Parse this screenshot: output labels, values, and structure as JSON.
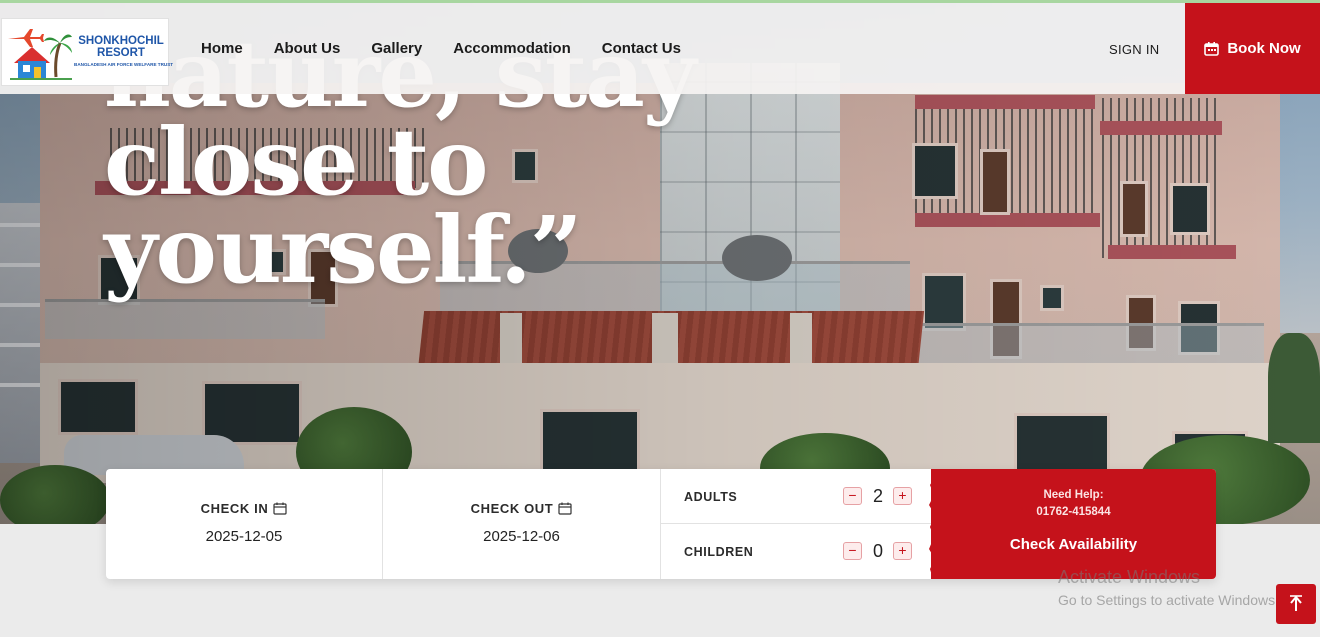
{
  "header": {
    "logo": {
      "title_line1": "SHONKHOCHIL",
      "title_line2": "RESORT",
      "subtitle": "BANGLADESH AIR FORCE WELFARE TRUST"
    },
    "nav": [
      "Home",
      "About Us",
      "Gallery",
      "Accommodation",
      "Contact Us"
    ],
    "sign_in": "SIGN IN",
    "book_now": "Book Now"
  },
  "hero": {
    "lines": [
      "nature, stay",
      "close to",
      "yourself.”"
    ]
  },
  "booking": {
    "check_in": {
      "label": "CHECK IN",
      "value": "2025-12-05"
    },
    "check_out": {
      "label": "CHECK OUT",
      "value": "2025-12-06"
    },
    "adults": {
      "label": "ADULTS",
      "value": "2"
    },
    "children": {
      "label": "CHILDREN",
      "value": "0"
    },
    "minus": "−",
    "plus": "+",
    "help_label": "Need Help:",
    "help_phone": "01762-415844",
    "cta": "Check Availability"
  },
  "watermark": {
    "title": "Activate Windows",
    "subtitle": "Go to Settings to activate Windows."
  },
  "icons": {
    "calendar": "calendar-icon",
    "scroll_top": "arrow-up-icon"
  },
  "colors": {
    "accent": "#c5121b",
    "logo_blue": "#1f56a8"
  }
}
